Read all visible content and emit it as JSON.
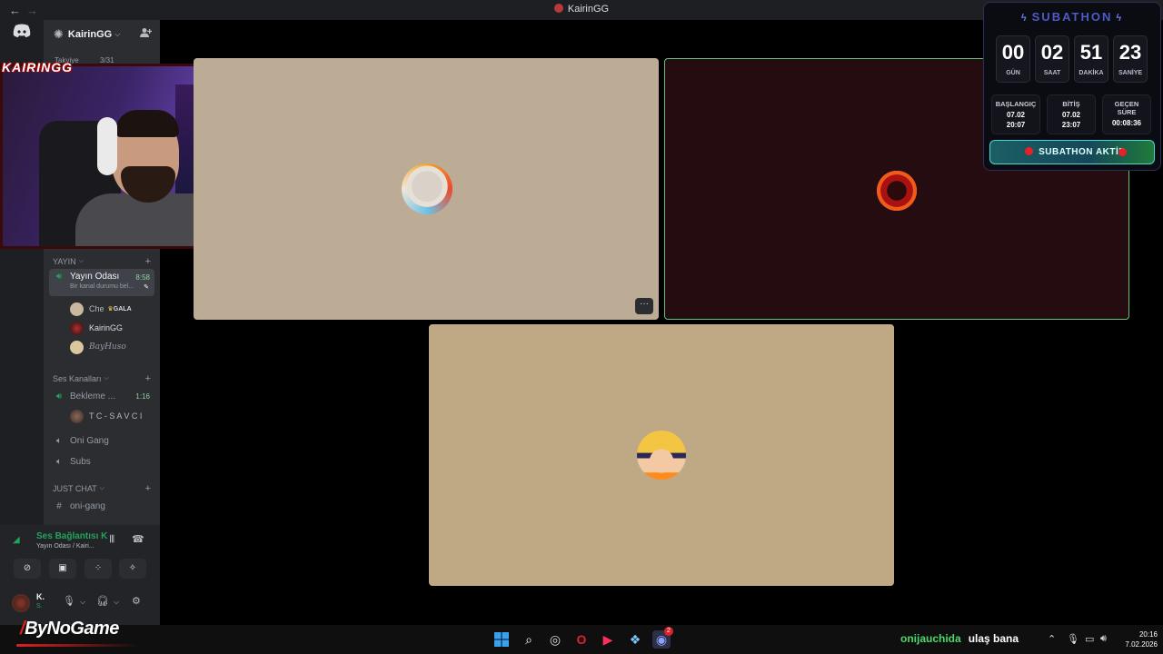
{
  "window": {
    "title": "KairinGG",
    "back": "←",
    "forward": "→"
  },
  "server": {
    "name": "KairinGG",
    "invite_icon": "add-user-icon",
    "stub_left": "Takviye",
    "stub_right": "3/31"
  },
  "webcam": {
    "logo": "KAIRINGG"
  },
  "channels": {
    "cat_yayin": "YAYIN",
    "active_channel": {
      "name": "Yayın Odası",
      "time": "8:58",
      "status": "Bir kanal durumu bel..."
    },
    "members_active": [
      {
        "name": "Che",
        "tag": "GALA"
      },
      {
        "name": "KairinGG"
      },
      {
        "name": "BayHuso"
      }
    ],
    "cat_ses": "Ses Kanalları",
    "bekleme": {
      "name": "Bekleme ...",
      "time": "1:16"
    },
    "bekleme_member": "T C - S A V C I",
    "oni_gang": "Oni Gang",
    "subs": "Subs",
    "cat_chat": "JUST CHAT",
    "oni_gang_text": "oni-gang"
  },
  "voice_panel": {
    "title": "Ses Bağlantısı K",
    "subtitle": "Yayın Odası / Kairi...",
    "user_name": "K.",
    "user_status": "S."
  },
  "subathon": {
    "title": "SUBATHON",
    "countdown": [
      {
        "value": "00",
        "label": "GÜN"
      },
      {
        "value": "02",
        "label": "SAAT"
      },
      {
        "value": "51",
        "label": "DAKİKA"
      },
      {
        "value": "23",
        "label": "SANİYE"
      }
    ],
    "start": {
      "label": "BAŞLANGIÇ",
      "date": "07.02",
      "time": "20:07"
    },
    "end": {
      "label": "BİTİŞ",
      "date": "07.02",
      "time": "23:07"
    },
    "elapsed": {
      "label": "GEÇEN SÜRE",
      "value": "00:08:36"
    },
    "status": "SUBATHON AKTİF"
  },
  "tiles": {
    "more_label": "···"
  },
  "taskbar": {
    "brand": "ByNoGame",
    "ticker_user": "onijauchida",
    "ticker_text": "ulaş bana",
    "time": "20:16",
    "date": "7.02.2026",
    "discord_badge": "2"
  },
  "colors": {
    "accent_green": "#23a559",
    "sidebar": "#2b2d31",
    "rail": "#1e1f22",
    "live_border": "#63c37a"
  }
}
